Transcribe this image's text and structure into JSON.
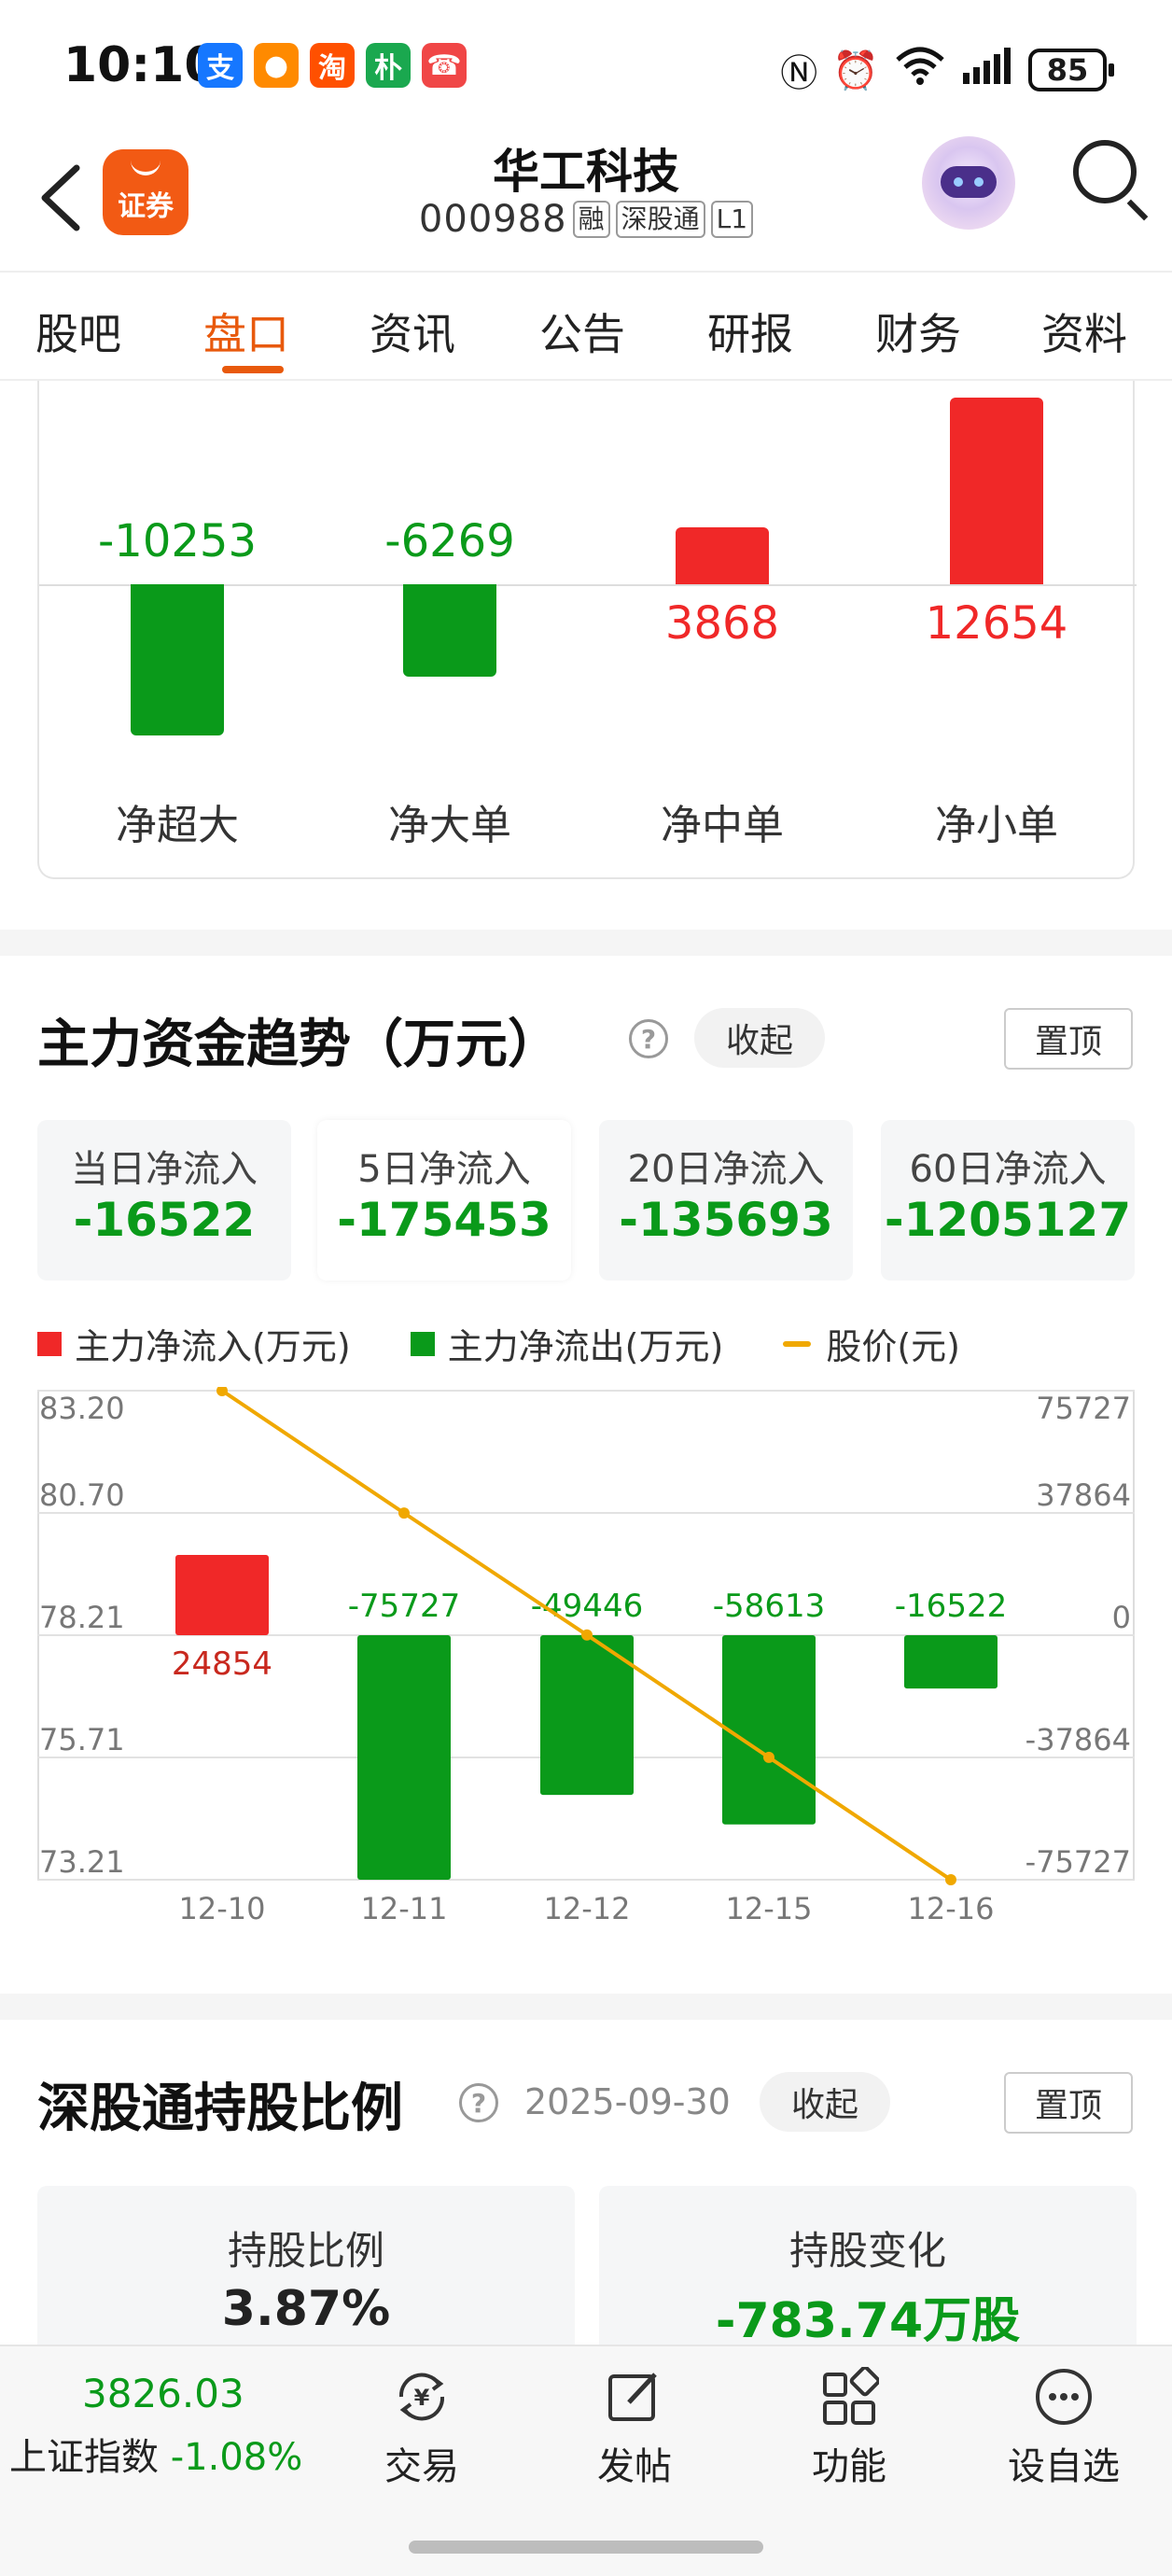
{
  "status_bar": {
    "time": "10:10",
    "apps": [
      {
        "glyph": "支",
        "color": "#1677ff",
        "icon": "alipay-icon"
      },
      {
        "glyph": "●",
        "color": "#ff8a00",
        "icon": "chat-app-icon"
      },
      {
        "glyph": "淘",
        "color": "#ff5000",
        "icon": "taobao-icon"
      },
      {
        "glyph": "朴",
        "color": "#1aa84f",
        "icon": "pupu-icon"
      },
      {
        "glyph": "☎",
        "color": "#f04646",
        "icon": "missed-call-icon"
      }
    ],
    "battery": "85"
  },
  "header": {
    "logo_text": "证券",
    "stock_name": "华工科技",
    "stock_code": "000988",
    "tags": [
      "融",
      "深股通",
      "L1"
    ]
  },
  "tabs": [
    "股吧",
    "盘口",
    "资讯",
    "公告",
    "研报",
    "财务",
    "资料"
  ],
  "active_tab": "盘口",
  "order_flow": {
    "categories": [
      "净超大",
      "净大单",
      "净中单",
      "净小单"
    ],
    "values": [
      -10253,
      -6269,
      3868,
      12654
    ],
    "value_labels": [
      "-10253",
      "-6269",
      "3868",
      "12654"
    ]
  },
  "trend": {
    "title": "主力资金趋势（万元）",
    "collapse_label": "收起",
    "pin_label": "置顶",
    "stats": [
      {
        "label": "当日净流入",
        "value": "-16522"
      },
      {
        "label": "5日净流入",
        "value": "-175453"
      },
      {
        "label": "20日净流入",
        "value": "-135693"
      },
      {
        "label": "60日净流入",
        "value": "-1205127"
      }
    ],
    "legend": [
      "主力净流入(万元)",
      "主力净流出(万元)",
      "股价(元)"
    ]
  },
  "chart_data": {
    "type": "bar",
    "categories": [
      "12-10",
      "12-11",
      "12-12",
      "12-15",
      "12-16"
    ],
    "series": [
      {
        "name": "主力净流入(万元)",
        "values": [
          24854,
          -75727,
          -49446,
          -58613,
          -16522
        ],
        "axis": "right"
      },
      {
        "name": "股价(元)",
        "values": [
          83.2,
          80.7,
          78.21,
          75.71,
          73.21
        ],
        "axis": "left",
        "type": "line"
      }
    ],
    "value_labels": [
      "24854",
      "-75727",
      "-49446",
      "-58613",
      "-16522"
    ],
    "left_ticks": [
      "83.20",
      "80.70",
      "78.21",
      "75.71",
      "73.21"
    ],
    "right_ticks": [
      "75727",
      "37864",
      "0",
      "-37864",
      "-75727"
    ],
    "left_ylim": [
      73.21,
      83.2
    ],
    "right_ylim": [
      -75727,
      75727
    ],
    "colors": {
      "inflow": "#f02828",
      "outflow": "#0a9a1a",
      "price": "#f0a800"
    },
    "grid": true,
    "legend_position": "top"
  },
  "holding": {
    "title": "深股通持股比例",
    "date": "2025-09-30",
    "collapse_label": "收起",
    "pin_label": "置顶",
    "ratio_label": "持股比例",
    "ratio_value": "3.87%",
    "change_label": "持股变化",
    "change_value": "-783.74万股"
  },
  "bottom_bar": {
    "index_value": "3826.03",
    "index_name": "上证指数",
    "index_change": "-1.08%",
    "nav": [
      "交易",
      "发帖",
      "功能",
      "设自选"
    ]
  },
  "colors": {
    "accent": "#e8590c",
    "up": "#f02828",
    "down": "#0a9a1a"
  }
}
